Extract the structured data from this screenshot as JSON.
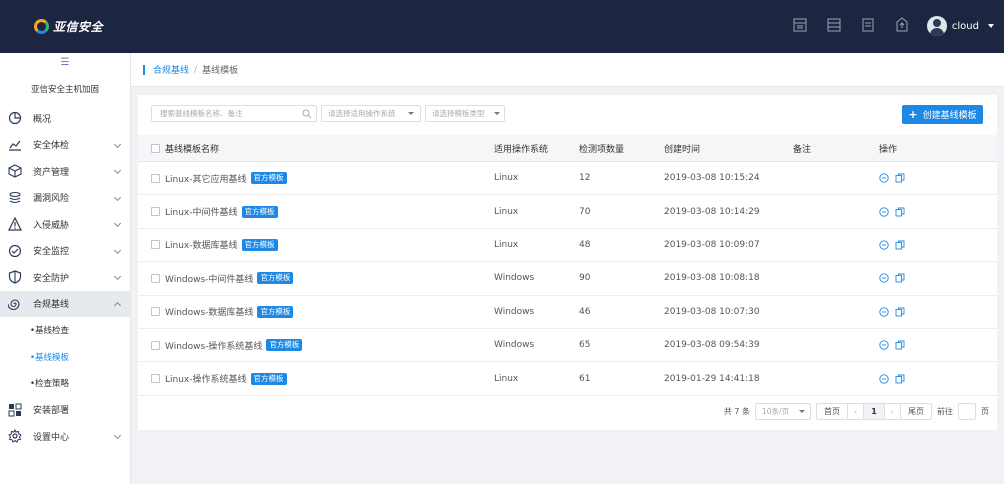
{
  "app": {
    "logo_text": "亚信安全",
    "user_name": "cloud"
  },
  "sidebar": {
    "title": "亚信安全主机加固",
    "items": [
      {
        "label": "概况",
        "icon": "pie-chart-icon",
        "has_arrow": false
      },
      {
        "label": "安全体检",
        "icon": "line-chart-icon",
        "has_arrow": true
      },
      {
        "label": "资产管理",
        "icon": "box-icon",
        "has_arrow": true
      },
      {
        "label": "漏洞风险",
        "icon": "layers-icon",
        "has_arrow": true
      },
      {
        "label": "入侵威胁",
        "icon": "warning-icon",
        "has_arrow": true
      },
      {
        "label": "安全监控",
        "icon": "monitor-icon",
        "has_arrow": true
      },
      {
        "label": "安全防护",
        "icon": "shield-icon",
        "has_arrow": true
      },
      {
        "label": "合规基线",
        "icon": "spiral-icon",
        "has_arrow": true,
        "active": true
      }
    ],
    "subitems": [
      {
        "label": "•基线检查"
      },
      {
        "label": "•基线模板",
        "active": true
      },
      {
        "label": "•检查策略"
      }
    ],
    "items_after": [
      {
        "label": "安装部署",
        "icon": "grid-icon",
        "has_arrow": false
      },
      {
        "label": "设置中心",
        "icon": "gear-icon",
        "has_arrow": true
      }
    ]
  },
  "breadcrumb": {
    "parent": "合规基线",
    "separator": "/",
    "current": "基线模板"
  },
  "filters": {
    "search_placeholder": "搜索基线模板名称、备注",
    "os_placeholder": "请选择适用操作系统",
    "type_placeholder": "请选择模板类型"
  },
  "create_button": {
    "label": "创建基线模板"
  },
  "table": {
    "headers": {
      "name": "基线模板名称",
      "os": "适用操作系统",
      "count": "检测项数量",
      "created": "创建时间",
      "note": "备注",
      "ops": "操作"
    },
    "rows": [
      {
        "name": "Linux-其它应用基线",
        "tag": "官方模板",
        "os": "Linux",
        "count": "12",
        "created": "2019-03-08 10:15:24",
        "note": ""
      },
      {
        "name": "Linux-中间件基线",
        "tag": "官方模板",
        "os": "Linux",
        "count": "70",
        "created": "2019-03-08 10:14:29",
        "note": ""
      },
      {
        "name": "Linux-数据库基线",
        "tag": "官方模板",
        "os": "Linux",
        "count": "48",
        "created": "2019-03-08 10:09:07",
        "note": ""
      },
      {
        "name": "Windows-中间件基线",
        "tag": "官方模板",
        "os": "Windows",
        "count": "90",
        "created": "2019-03-08 10:08:18",
        "note": ""
      },
      {
        "name": "Windows-数据库基线",
        "tag": "官方模板",
        "os": "Windows",
        "count": "46",
        "created": "2019-03-08 10:07:30",
        "note": ""
      },
      {
        "name": "Windows-操作系统基线",
        "tag": "官方模板",
        "os": "Windows",
        "count": "65",
        "created": "2019-03-08 09:54:39",
        "note": ""
      },
      {
        "name": "Linux-操作系统基线",
        "tag": "官方模板",
        "os": "Linux",
        "count": "61",
        "created": "2019-01-29 14:41:18",
        "note": ""
      }
    ]
  },
  "pagination": {
    "total": "共 7 条",
    "page_size": "10条/页",
    "first": "首页",
    "prev": "‹",
    "current": "1",
    "next": "›",
    "last": "尾页",
    "goto_prefix": "前往",
    "goto_suffix": "页"
  }
}
